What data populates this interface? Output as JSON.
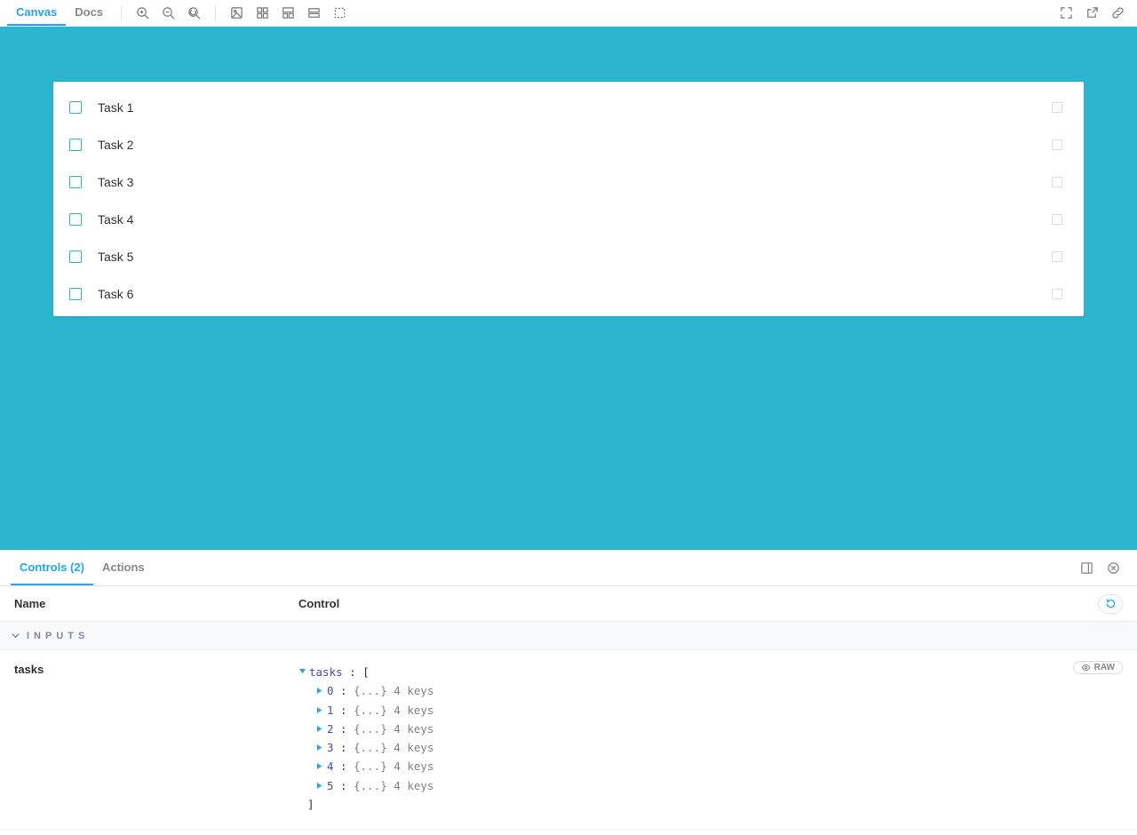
{
  "toolbar": {
    "tabs": {
      "canvas": "Canvas",
      "docs": "Docs"
    }
  },
  "tasks": [
    {
      "label": "Task 1"
    },
    {
      "label": "Task 2"
    },
    {
      "label": "Task 3"
    },
    {
      "label": "Task 4"
    },
    {
      "label": "Task 5"
    },
    {
      "label": "Task 6"
    }
  ],
  "panel": {
    "tabs": {
      "controls": "Controls (2)",
      "actions": "Actions"
    },
    "cols": {
      "name": "Name",
      "control": "Control"
    },
    "section_inputs": "INPUTS",
    "row": {
      "name": "tasks",
      "raw": "RAW",
      "tree": {
        "root_key": "tasks",
        "open_bracket": "[",
        "close_bracket": "]",
        "items": [
          {
            "idx": "0",
            "summary": "{...} 4 keys"
          },
          {
            "idx": "1",
            "summary": "{...} 4 keys"
          },
          {
            "idx": "2",
            "summary": "{...} 4 keys"
          },
          {
            "idx": "3",
            "summary": "{...} 4 keys"
          },
          {
            "idx": "4",
            "summary": "{...} 4 keys"
          },
          {
            "idx": "5",
            "summary": "{...} 4 keys"
          }
        ]
      }
    }
  }
}
